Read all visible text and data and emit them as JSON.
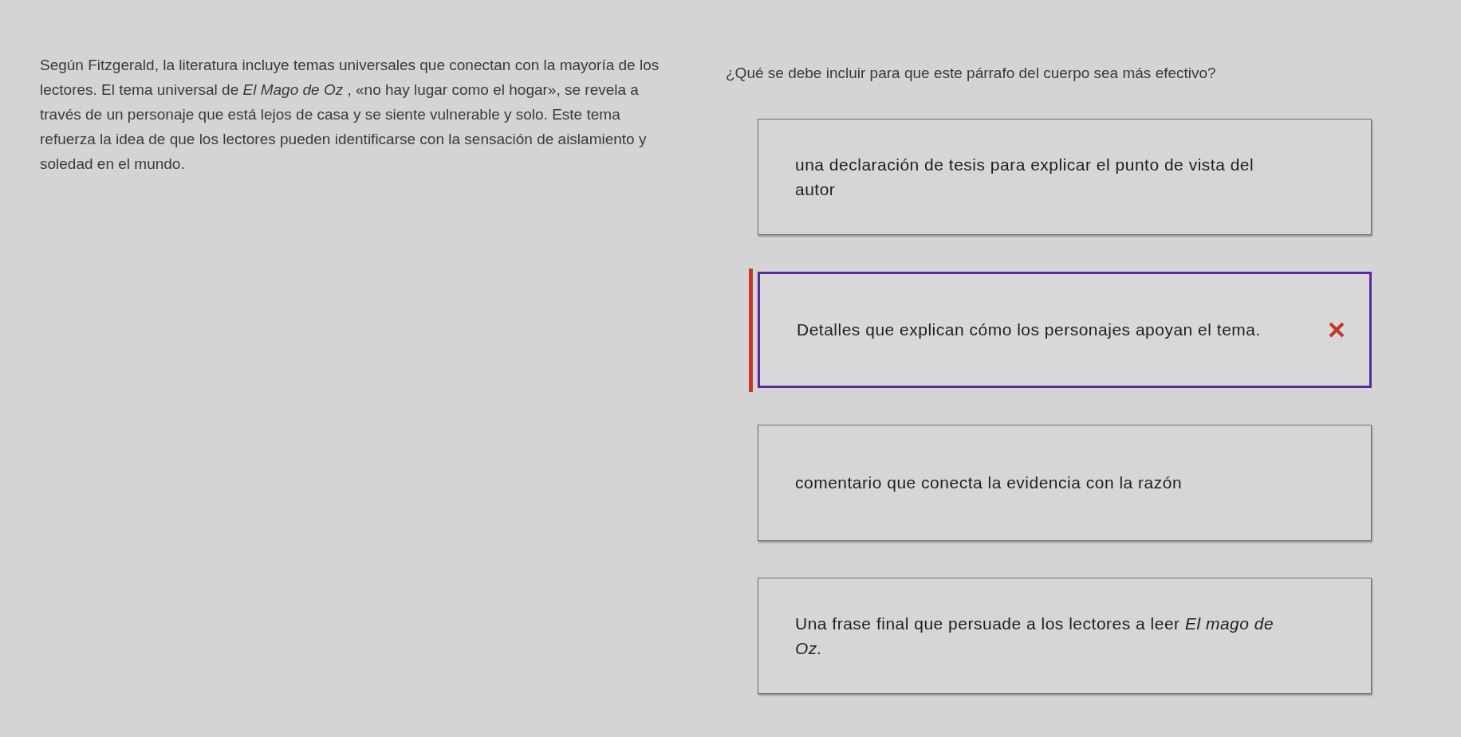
{
  "passage": "Según Fitzgerald, la literatura incluye temas universales que conectan con la mayoría de los lectores. El tema universal de *El Mago de Oz* , «no hay lugar como el hogar», se revela a través de un personaje que está lejos de casa y se siente vulnerable y solo. Este tema refuerza la idea de que los lectores pueden identificarse con la sensación de aislamiento y soledad en el mundo.",
  "question": "¿Qué se debe incluir para que este párrafo del cuerpo sea más efectivo?",
  "options": [
    {
      "text": "una declaración de tesis para explicar el punto de vista del autor",
      "selected": false,
      "incorrect": false
    },
    {
      "text": "Detalles que explican cómo los personajes apoyan el tema.",
      "selected": true,
      "incorrect": true
    },
    {
      "text": "comentario que conecta la evidencia con la razón",
      "selected": false,
      "incorrect": false
    },
    {
      "text": "Una frase final que persuade a los lectores a leer *El mago de Oz.*",
      "selected": false,
      "incorrect": false
    }
  ]
}
